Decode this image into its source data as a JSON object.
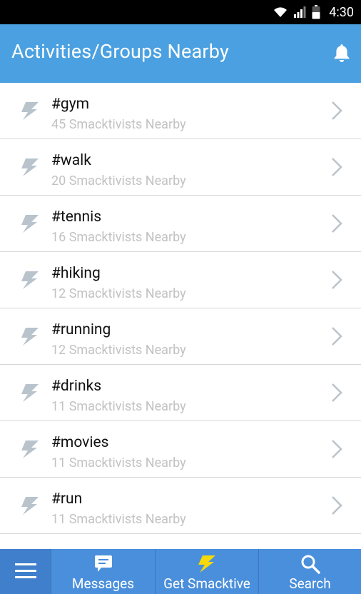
{
  "status_bar": {
    "time": "4:30",
    "icons": [
      "wifi-icon",
      "signal-icon",
      "battery-icon"
    ]
  },
  "header": {
    "title": "Activities/Groups Nearby",
    "icons": [
      "bell-icon"
    ]
  },
  "list": {
    "items": [
      {
        "tag": "#gym",
        "subtitle": "45 Smacktivists Nearby"
      },
      {
        "tag": "#walk",
        "subtitle": "20 Smacktivists Nearby"
      },
      {
        "tag": "#tennis",
        "subtitle": "16 Smacktivists Nearby"
      },
      {
        "tag": "#hiking",
        "subtitle": "12 Smacktivists Nearby"
      },
      {
        "tag": "#running",
        "subtitle": "12 Smacktivists Nearby"
      },
      {
        "tag": "#drinks",
        "subtitle": "11 Smacktivists Nearby"
      },
      {
        "tag": "#movies",
        "subtitle": "11 Smacktivists Nearby"
      },
      {
        "tag": "#run",
        "subtitle": "11 Smacktivists Nearby"
      }
    ]
  },
  "bottom_nav": {
    "items": [
      {
        "icon": "menu-icon",
        "label": ""
      },
      {
        "icon": "chat-icon",
        "label": "Messages"
      },
      {
        "icon": "lightning-icon",
        "label": "Get Smacktive"
      },
      {
        "icon": "search-icon",
        "label": "Search"
      }
    ]
  },
  "colors": {
    "header": "#4aa0e0",
    "bottom_nav": "#4a8fdb",
    "subtitle": "#c2c2c2",
    "accent_bolt": "#f5d90a"
  }
}
